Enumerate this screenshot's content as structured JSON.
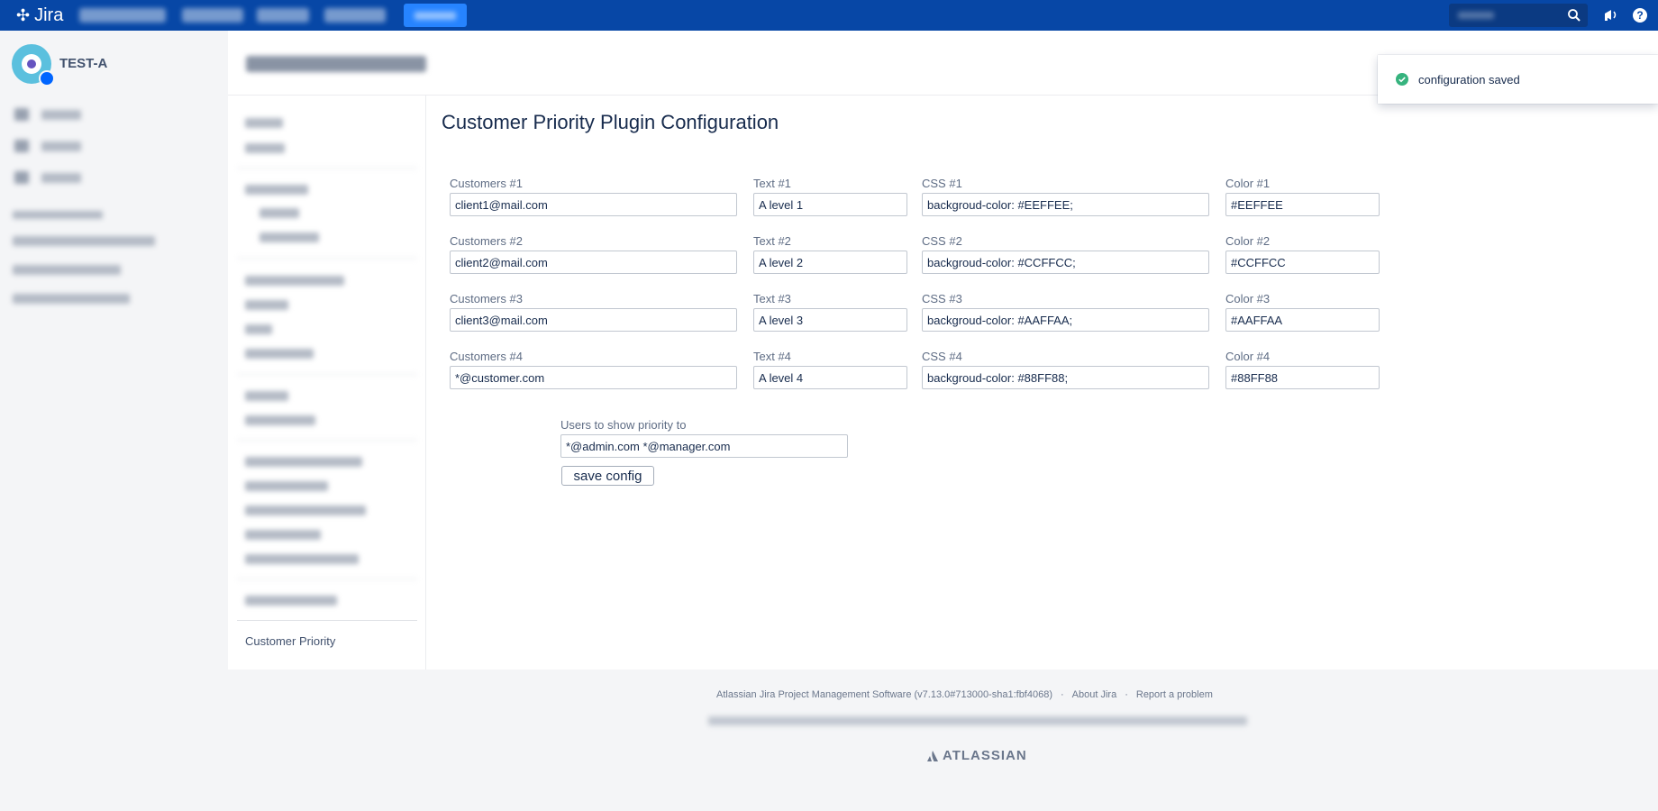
{
  "app": {
    "name": "Jira"
  },
  "project": {
    "name": "TEST-A"
  },
  "page": {
    "title": "Customer Priority Plugin Configuration"
  },
  "settings_nav": {
    "active_item": "Customer Priority"
  },
  "rows": [
    {
      "customers_label": "Customers #1",
      "customers_value": "client1@mail.com",
      "text_label": "Text #1",
      "text_value": "A level 1",
      "css_label": "CSS #1",
      "css_value": "backgroud-color: #EEFFEE;",
      "color_label": "Color #1",
      "color_value": "#EEFFEE"
    },
    {
      "customers_label": "Customers #2",
      "customers_value": "client2@mail.com",
      "text_label": "Text #2",
      "text_value": "A level 2",
      "css_label": "CSS #2",
      "css_value": "backgroud-color: #CCFFCC;",
      "color_label": "Color #2",
      "color_value": "#CCFFCC"
    },
    {
      "customers_label": "Customers #3",
      "customers_value": "client3@mail.com",
      "text_label": "Text #3",
      "text_value": "A level 3",
      "css_label": "CSS #3",
      "css_value": "backgroud-color: #AAFFAA;",
      "color_label": "Color #3",
      "color_value": "#AAFFAA"
    },
    {
      "customers_label": "Customers #4",
      "customers_value": "*@customer.com",
      "text_label": "Text #4",
      "text_value": "A level 4",
      "css_label": "CSS #4",
      "css_value": "backgroud-color: #88FF88;",
      "color_label": "Color #4",
      "color_value": "#88FF88"
    }
  ],
  "users_field": {
    "label": "Users to show priority to",
    "value": "*@admin.com *@manager.com"
  },
  "save_button": {
    "label": "save config"
  },
  "toast": {
    "message": "configuration saved",
    "icon": "check-circle-icon"
  },
  "footer": {
    "software": "Atlassian Jira Project Management Software (v7.13.0#713000-sha1:fbf4068)",
    "about": "About Jira",
    "report": "Report a problem",
    "brand": "ATLASSIAN"
  },
  "colors": {
    "topbar": "#0747a6",
    "create_button": "#2684ff",
    "toast_success": "#36b37e"
  }
}
